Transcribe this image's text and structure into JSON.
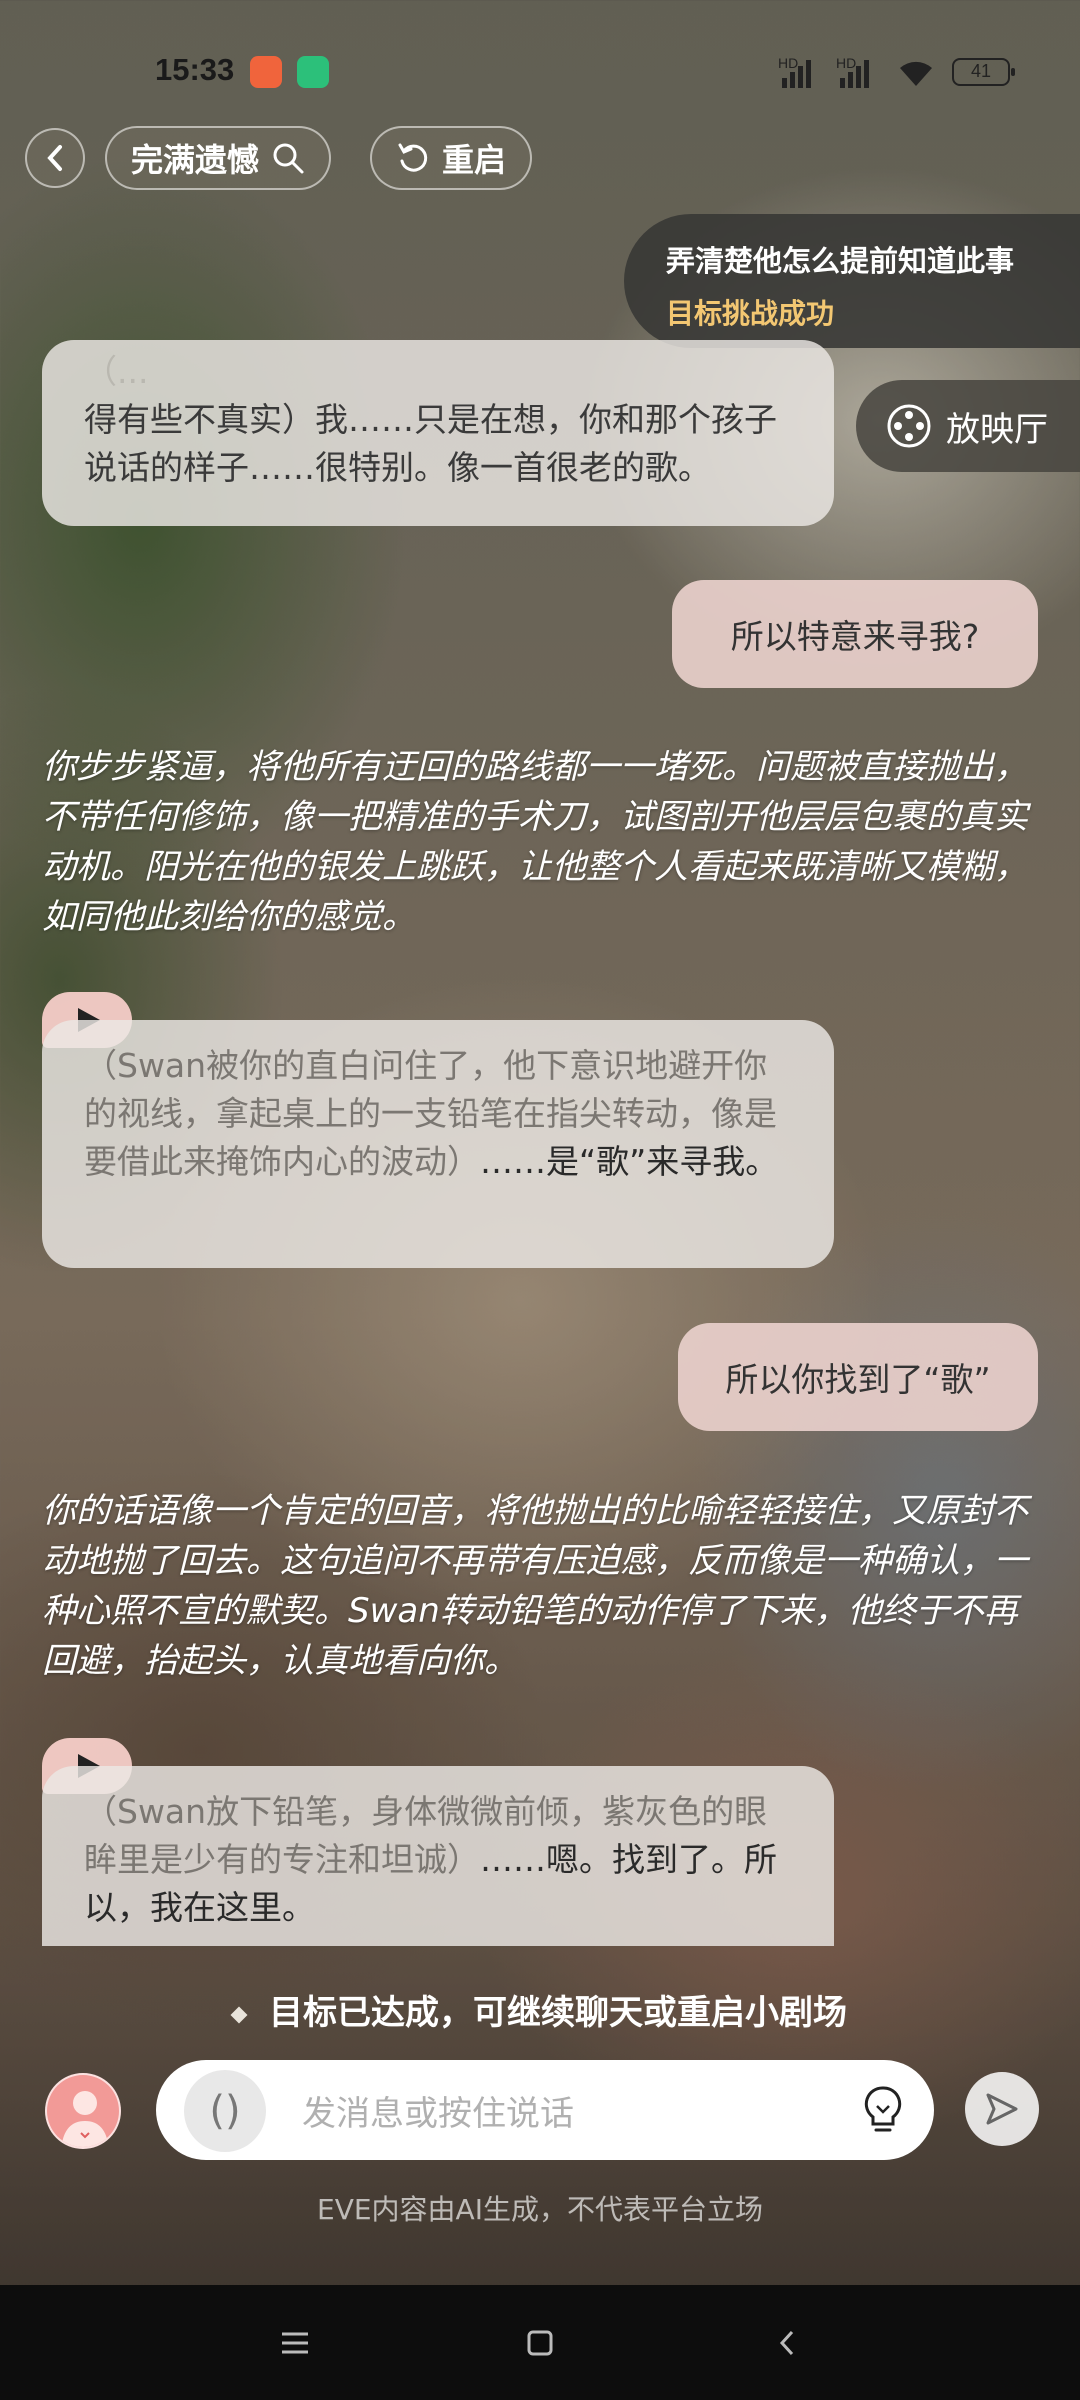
{
  "status_bar": {
    "time": "15:33",
    "signal1": "HD",
    "signal2": "HD",
    "battery": "41"
  },
  "header": {
    "title_pill": "完满遗憾",
    "restart_label": "重启"
  },
  "goal_card": {
    "line1": "弄清楚他怎么提前知道此事",
    "line2": "目标挑战成功"
  },
  "cinema_label": "放映厅",
  "messages": {
    "m1": {
      "paren_top": "（...",
      "text": "得有些不真实）我……只是在想，你和那个孩子说话的样子……很特别。像一首很老的歌。"
    },
    "u1": "所以特意来寻我?",
    "n1": "你步步紧逼，将他所有迂回的路线都一一堵死。问题被直接抛出，不带任何修饰，像一把精准的手术刀，试图剖开他层层包裹的真实动机。阳光在他的银发上跳跃，让他整个人看起来既清晰又模糊，如同他此刻给你的感觉。",
    "m2": {
      "paren": "（Swan被你的直白问住了，他下意识地避开你的视线，拿起桌上的一支铅笔在指尖转动，像是要借此来掩饰内心的波动）",
      "spoken": "……是“歌”来寻我。"
    },
    "u2": "所以你找到了“歌”",
    "n2": "你的话语像一个肯定的回音，将他抛出的比喻轻轻接住，又原封不动地抛了回去。这句追问不再带有压迫感，反而像是一种确认，一种心照不宣的默契。Swan转动铅笔的动作停了下来，他终于不再回避，抬起头，认真地看向你。",
    "m3": {
      "paren": "（Swan放下铅笔，身体微微前倾，紫灰色的眼眸里是少有的专注和坦诚）",
      "spoken": "……嗯。找到了。所以，我在这里。"
    }
  },
  "goal_status": "目标已达成，可继续聊天或重启小剧场",
  "composer": {
    "placeholder": "发消息或按住说话",
    "voice_glyph": "()"
  },
  "disclaimer": "EVE内容由AI生成，不代表平台立场",
  "icons": [
    "back-icon",
    "search-icon",
    "restart-icon",
    "cinema-icon",
    "play-icon",
    "voice-icon",
    "bulb-icon",
    "send-icon",
    "menu-icon",
    "home-icon",
    "nav-back-icon"
  ],
  "colors": {
    "goal_accent": "#f3c772",
    "user_bubble": "#ebd2cd",
    "play_badge": "#f5cdc8"
  }
}
